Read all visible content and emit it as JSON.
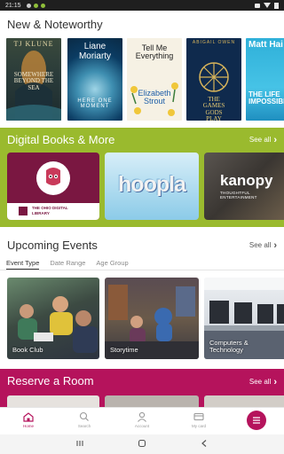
{
  "status_bar": {
    "time": "21:15"
  },
  "new_noteworthy": {
    "title": "New & Noteworthy",
    "books": [
      {
        "author": "TJ KLUNE",
        "title": "SOMEWHERE BEYOND THE SEA"
      },
      {
        "author": "Liane Moriarty",
        "title": "HERE ONE MOMENT"
      },
      {
        "author": "Elizabeth Strout",
        "title": "Tell Me Everything"
      },
      {
        "author": "ABIGAIL OWEN",
        "title": "THE GAMES GODS PLAY"
      },
      {
        "author": "Matt Hai",
        "title": "THE LIFE IMPOSSIBLE"
      }
    ]
  },
  "digital": {
    "title": "Digital Books & More",
    "see_all": "See all",
    "cards": [
      {
        "name": "THE OHIO DIGITAL LIBRARY"
      },
      {
        "name": "hoopla"
      },
      {
        "name": "kanopy",
        "tagline": "THOUGHTFUL ENTERTAINMENT"
      }
    ]
  },
  "events": {
    "title": "Upcoming Events",
    "see_all": "See all",
    "tabs": [
      "Event Type",
      "Date Range",
      "Age Group"
    ],
    "cards": [
      {
        "label": "Book Club"
      },
      {
        "label": "Storytime"
      },
      {
        "label": "Computers & Technology"
      }
    ]
  },
  "reserve": {
    "title": "Reserve a Room",
    "see_all": "See all"
  },
  "bottom_nav": {
    "items": [
      {
        "label": "Home",
        "icon": "home-icon"
      },
      {
        "label": "Search",
        "icon": "search-icon"
      },
      {
        "label": "Account",
        "icon": "account-icon"
      },
      {
        "label": "My card",
        "icon": "card-icon"
      }
    ]
  },
  "colors": {
    "lime": "#9aba2e",
    "magenta": "#b5135c",
    "status_bar": "#1f1f1f"
  }
}
